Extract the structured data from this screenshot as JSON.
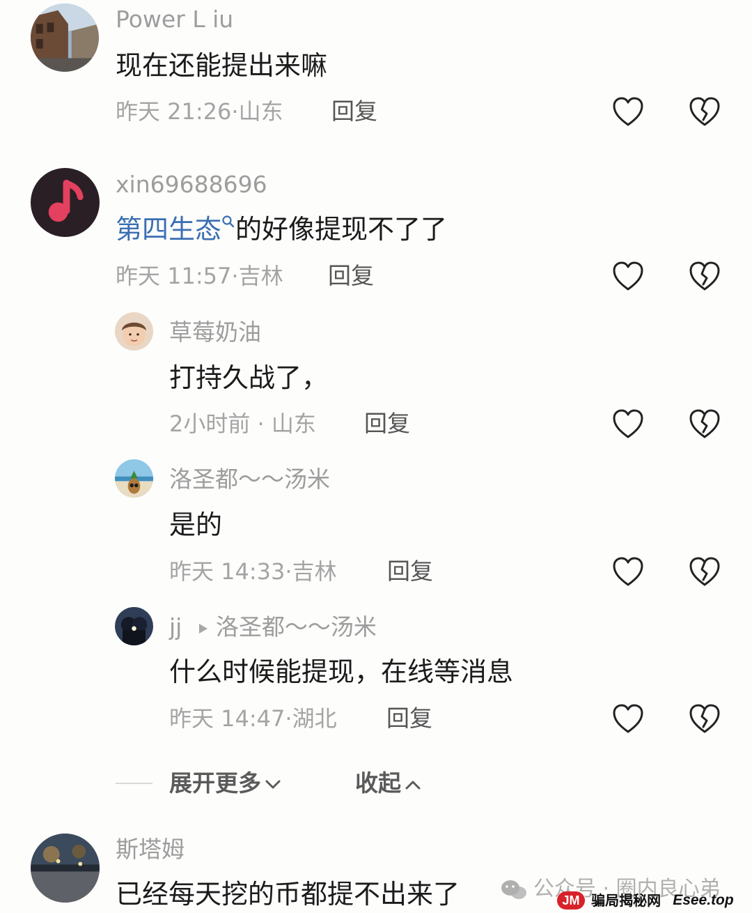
{
  "comments": [
    {
      "user": "Power L iu",
      "text": "现在还能提出来嘛",
      "time": "昨天 21:26",
      "location": "山东",
      "reply_label": "回复"
    },
    {
      "user": "xin69688696",
      "topic": "第四生态",
      "text": "的好像提现不了了",
      "time": "昨天 11:57",
      "location": "吉林",
      "reply_label": "回复",
      "replies": [
        {
          "user": "草莓奶油",
          "text": "打持久战了，",
          "time": "2小时前",
          "location": "山东",
          "reply_label": "回复"
        },
        {
          "user": "洛圣都～～汤米",
          "text": "是的",
          "time": "昨天 14:33",
          "location": "吉林",
          "reply_label": "回复"
        },
        {
          "user": "jj",
          "reply_to": "洛圣都～～汤米",
          "text": "什么时候能提现，在线等消息",
          "time": "昨天 14:47",
          "location": "湖北",
          "reply_label": "回复"
        }
      ]
    },
    {
      "user": "斯塔姆",
      "text": "已经每天挖的币都提不出来了"
    }
  ],
  "thread_controls": {
    "expand_label": "展开更多",
    "collapse_label": "收起"
  },
  "watermarks": {
    "wechat": "公众号 · 圈内良心弟",
    "site_logo": "JM",
    "site_name": "骗局揭秘网",
    "site_domain": "Esee.top"
  },
  "icons": {
    "like": "heart-outline-icon",
    "dislike": "broken-heart-icon",
    "search_topic": "search-icon",
    "reply_to_arrow": "triangle-right-icon",
    "expand": "chevron-down-icon",
    "collapse": "chevron-up-icon"
  }
}
